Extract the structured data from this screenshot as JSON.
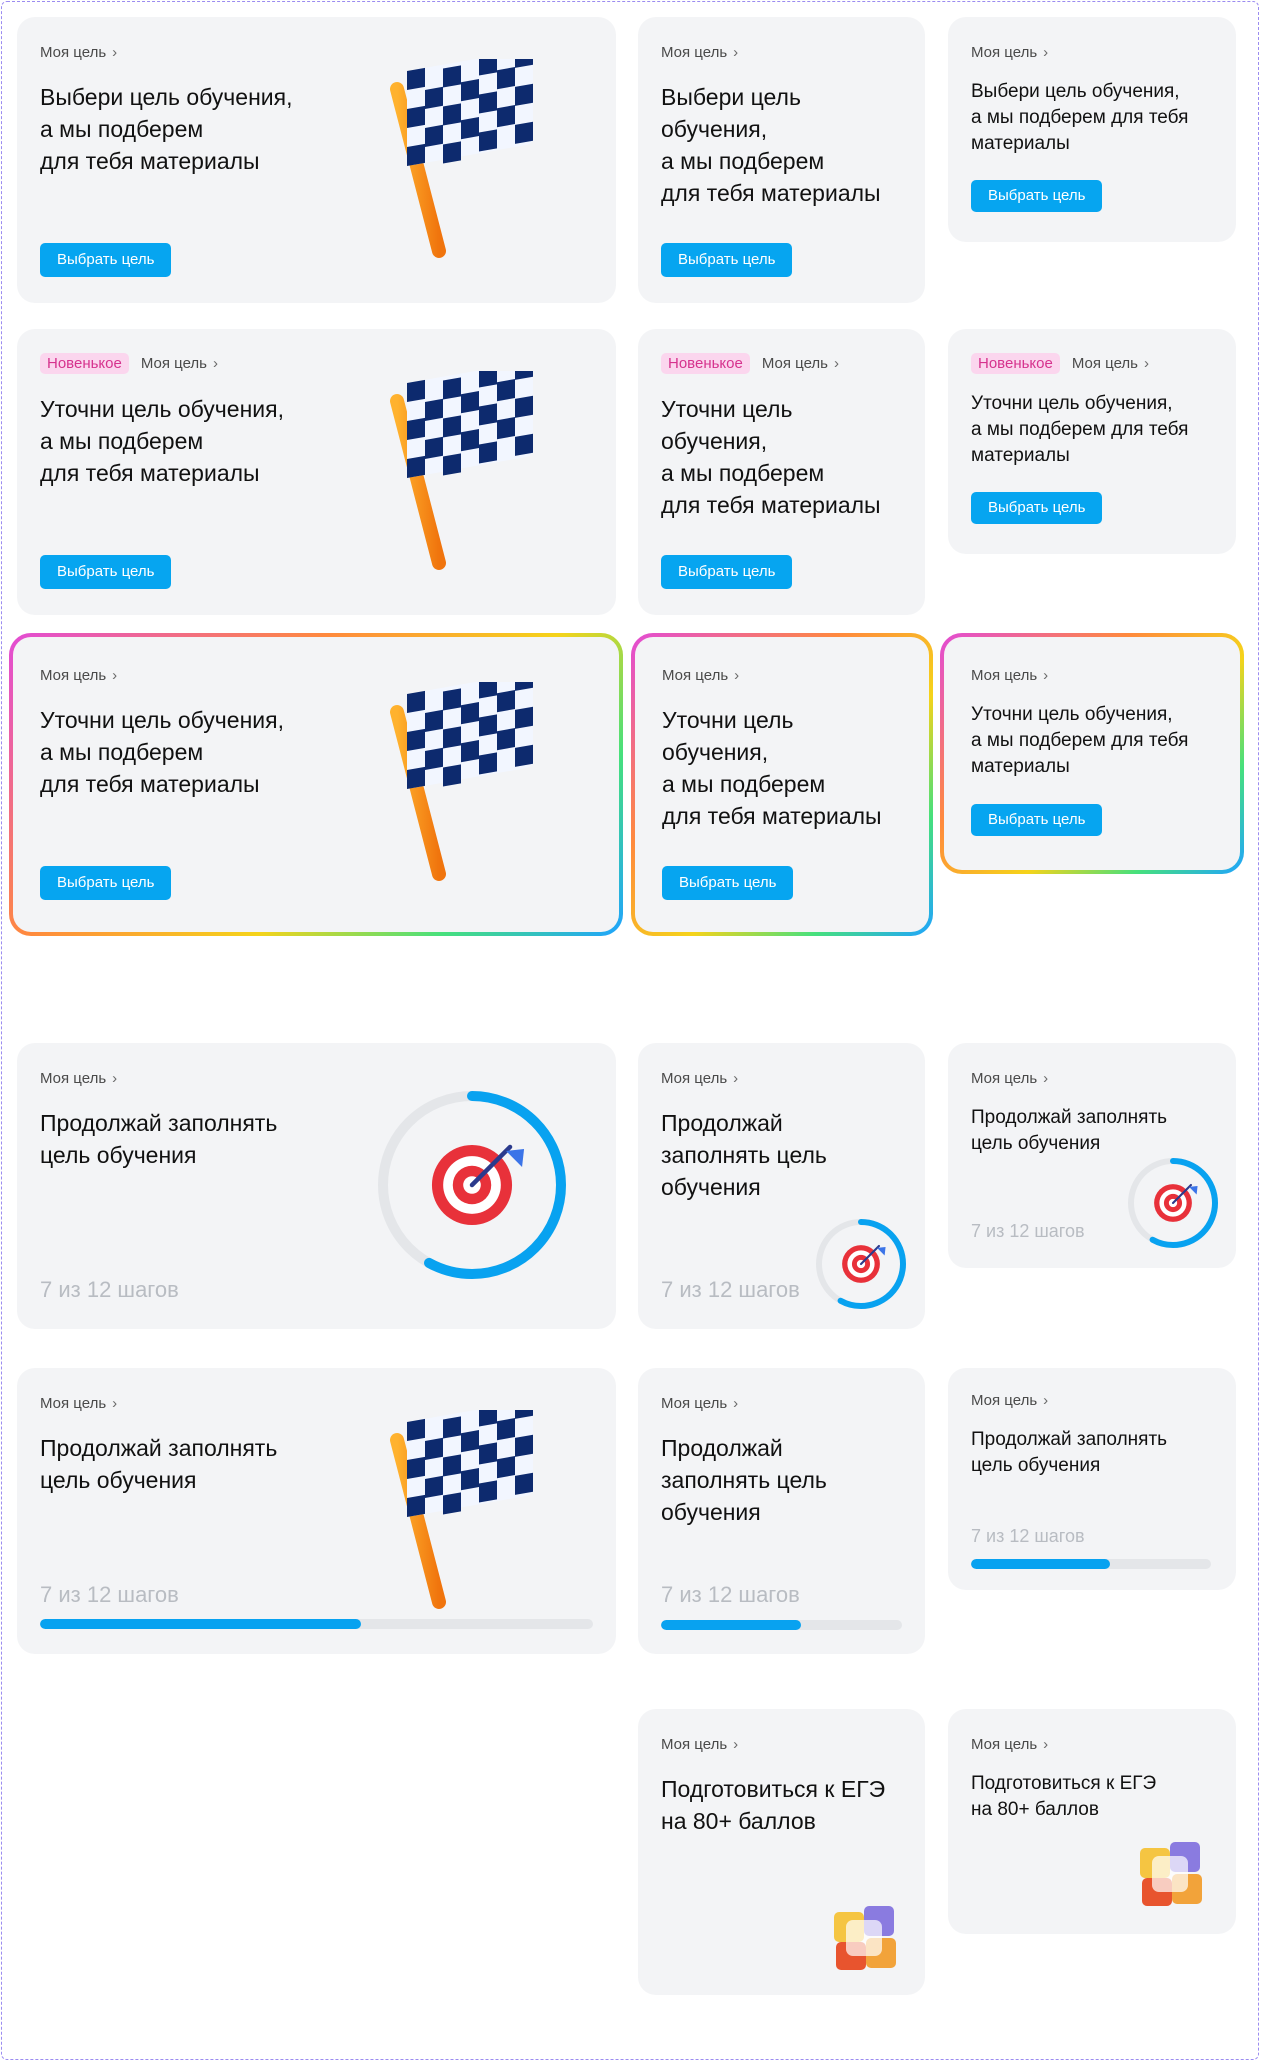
{
  "crumb": "Моя цель",
  "badge": "Новенькое",
  "choose_btn": "Выбрать цель",
  "titles": {
    "choose": "Выбери цель обучения,\nа мы подберем\nдля тебя материалы",
    "choose_narrow": "Выбери цель\nобучения,\nа мы подберем\nдля тебя материалы",
    "choose_small": "Выбери цель обучения,\nа мы подберем для тебя\nматериалы",
    "refine": "Уточни цель обучения,\nа мы подберем\nдля тебя материалы",
    "refine_narrow": "Уточни цель\nобучения,\nа мы подберем\nдля тебя материалы",
    "refine_small": "Уточни цель обучения,\nа мы подберем для тебя\nматериалы",
    "continue": "Продолжай заполнять\nцель обучения",
    "continue_narrow": "Продолжай\nзаполнять цель\nобучения",
    "continue_small": "Продолжай заполнять\nцель обучения",
    "ege_mid": "Подготовиться к ЕГЭ\nна 80+ баллов",
    "ege_small": "Подготовиться к ЕГЭ\nна 80+ баллов"
  },
  "steps": "7 из 12 шагов",
  "progress": 0.58,
  "icons": {
    "flag": "checkered-flag-icon",
    "target": "target-icon",
    "cube": "cube-icon",
    "chevron": "chevron-right-icon"
  },
  "colors": {
    "accent": "#06a5f0",
    "card": "#f3f4f6",
    "badge_bg": "#fbd6ee",
    "badge_fg": "#d6338e"
  }
}
